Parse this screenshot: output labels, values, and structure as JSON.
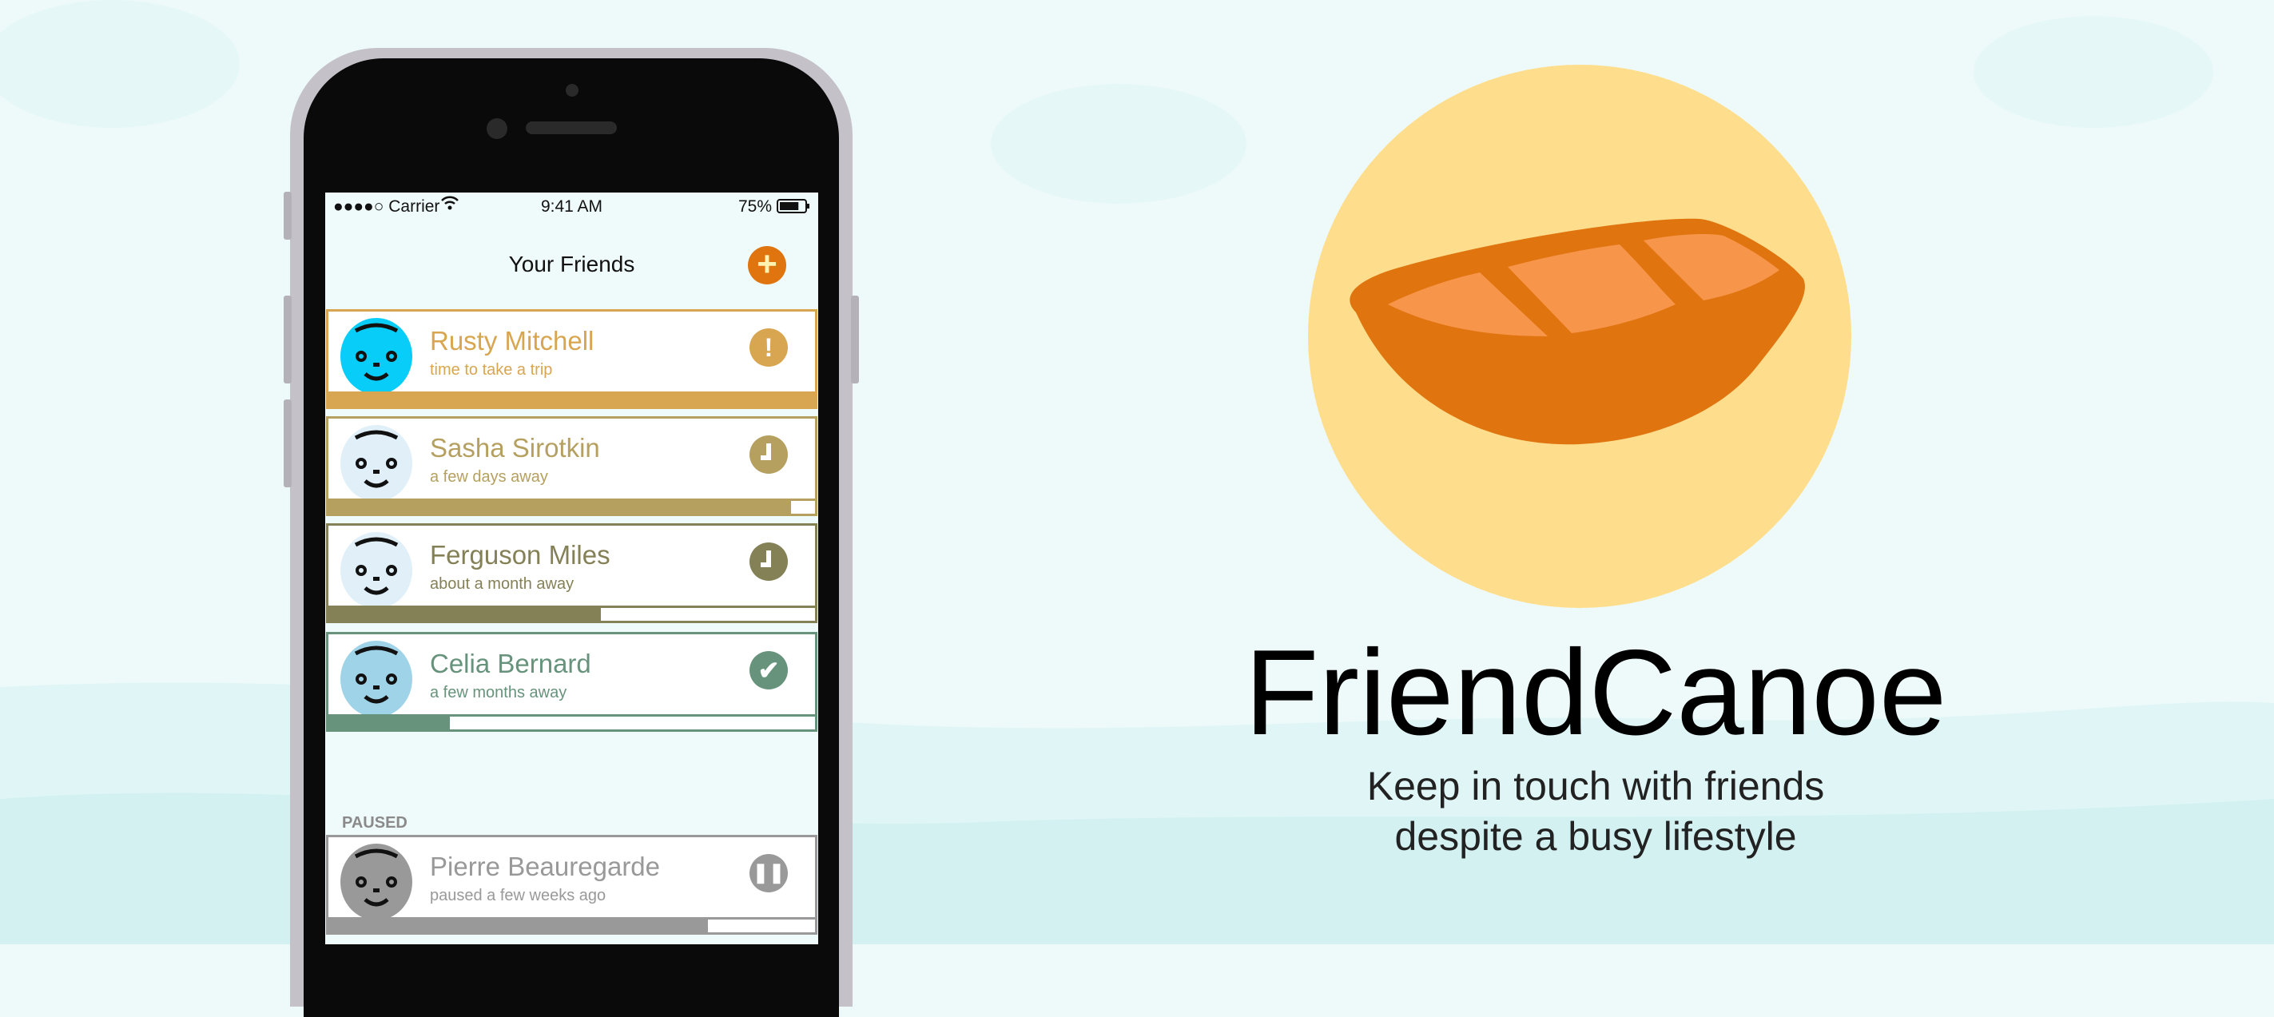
{
  "colors": {
    "background": "#eefafa",
    "wave": "#d6f2f3",
    "accent": "#e0740f",
    "logo_circle": "#fede8c",
    "canoe_light": "#f7954a"
  },
  "status_bar": {
    "carrier": "●●●●○ Carrier",
    "time": "9:41 AM",
    "battery": "75%",
    "battery_level": 0.75
  },
  "nav": {
    "title": "Your Friends",
    "add_icon": "plus-icon",
    "add_label": "+"
  },
  "friends": [
    {
      "name": "Rusty Mitchell",
      "status": "time to take a trip",
      "icon": "exclamation-icon",
      "glyph": "!",
      "color": "#d8a651",
      "avatar_color": "#07cdf8",
      "progress": 1.0
    },
    {
      "name": "Sasha Sirotkin",
      "status": "a few days away",
      "icon": "clock-icon",
      "glyph": "",
      "color": "#b5a060",
      "avatar_color": "#e0eff8",
      "progress": 0.95
    },
    {
      "name": "Ferguson Miles",
      "status": "about a month away",
      "icon": "clock-icon",
      "glyph": "",
      "color": "#848157",
      "avatar_color": "#e0eff8",
      "progress": 0.56
    },
    {
      "name": "Celia Bernard",
      "status": "a few months away",
      "icon": "check-icon",
      "glyph": "✔",
      "color": "#67937c",
      "avatar_color": "#9fd3e8",
      "progress": 0.25
    }
  ],
  "paused_section": {
    "label": "PAUSED"
  },
  "paused_friends": [
    {
      "name": "Pierre Beauregarde",
      "status": "paused a few weeks ago",
      "icon": "pause-icon",
      "glyph": "❚❚",
      "color": "#999999",
      "avatar_color": "#999999",
      "progress": 0.78
    }
  ],
  "brand": {
    "name": "FriendCanoe",
    "tagline_1": "Keep in touch with friends",
    "tagline_2": "despite a busy lifestyle"
  }
}
